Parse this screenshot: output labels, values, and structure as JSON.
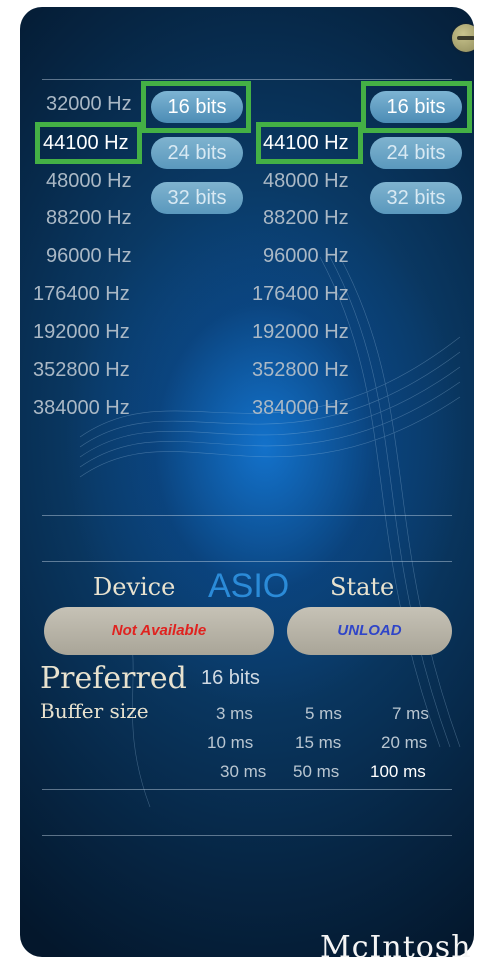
{
  "left_rates": [
    "32000 Hz",
    "44100 Hz",
    "48000 Hz",
    "88200 Hz",
    "96000 Hz",
    "176400 Hz",
    "192000 Hz",
    "352800 Hz",
    "384000 Hz"
  ],
  "right_rates": [
    "44100 Hz",
    "48000 Hz",
    "88200 Hz",
    "96000 Hz",
    "176400 Hz",
    "192000 Hz",
    "352800 Hz",
    "384000 Hz"
  ],
  "left_bits": [
    "16 bits",
    "24 bits",
    "32 bits"
  ],
  "right_bits": [
    "16 bits",
    "24 bits",
    "32 bits"
  ],
  "selected": {
    "left_rate": "44100 Hz",
    "left_bits": "16 bits",
    "right_rate": "44100 Hz",
    "right_bits": "16 bits"
  },
  "asio": {
    "device_label": "Device",
    "title": "ASIO",
    "state_label": "State",
    "device_value": "Not Available",
    "state_value": "UNLOAD"
  },
  "preferred": {
    "label": "Preferred",
    "bits": "16 bits",
    "buffer_label": "Buffer size",
    "buffer_options": [
      "3 ms",
      "5 ms",
      "7 ms",
      "10 ms",
      "15 ms",
      "20 ms",
      "30 ms",
      "50 ms",
      "100 ms"
    ],
    "buffer_selected": "100 ms"
  },
  "brand": "McIntosh",
  "colors": {
    "highlight": "#44b045",
    "not_available": "#e0221f",
    "unload": "#2f45c8",
    "asio": "#2b8bd8"
  }
}
